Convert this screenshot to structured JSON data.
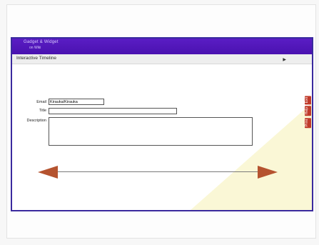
{
  "window": {
    "title_line1": "Gadget & Widget",
    "title_line2": "on Wiki"
  },
  "toolbar": {
    "app_title": "Interactive Timeline",
    "nav_prev": "",
    "nav_next": ""
  },
  "side_tabs": [
    "Exit",
    "Help",
    "Print"
  ],
  "form": {
    "email_label": "Email",
    "email_value": "Kirauka/Kirauka",
    "title_label": "Title",
    "title_value": "",
    "description_label": "Description",
    "description_value": ""
  },
  "timeline": {
    "date_start": "",
    "date_end": "",
    "start_label": ""
  },
  "colors": {
    "titlebar": "#5a1dc4",
    "arrow": "#b5532f",
    "side_tab": "#c03a2a"
  }
}
